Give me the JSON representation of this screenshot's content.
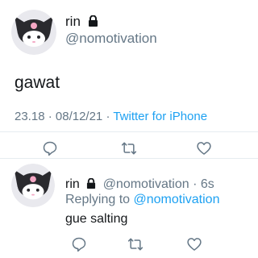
{
  "tweet": {
    "display_name": "rin",
    "username": "@nomotivation",
    "text": "gawat",
    "time": "23.18",
    "separator": " · ",
    "date": "08/12/21",
    "source": "Twitter for iPhone"
  },
  "actions": [
    {
      "name": "reply",
      "icon": "reply-icon"
    },
    {
      "name": "retweet",
      "icon": "retweet-icon"
    },
    {
      "name": "like",
      "icon": "heart-icon"
    }
  ],
  "reply": {
    "display_name": "rin",
    "username": "@nomotivation",
    "dot": "·",
    "time": "6s",
    "replying_prefix": "Replying to ",
    "replying_mention": "@nomotivation",
    "text": "gue salting"
  },
  "colors": {
    "link": "#1da1f2",
    "secondary_text": "#657786",
    "primary_text": "#14171a",
    "divider": "#e6ecf0"
  }
}
